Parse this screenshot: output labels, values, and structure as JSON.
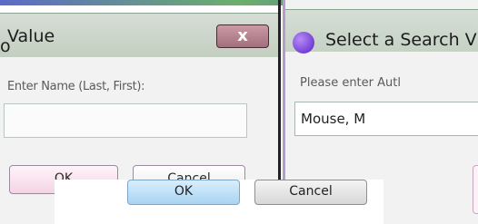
{
  "left_dialog": {
    "title": "Value",
    "close_label": "x",
    "prompt": "Enter Name (Last, First):",
    "input_value": "",
    "ok_label": "OK",
    "cancel_label": "Cancel"
  },
  "right_dialog": {
    "title": "Select a Search V",
    "prompt": "Please enter Autl",
    "input_value": "Mouse, M"
  },
  "overlay": {
    "ok_label": "OK",
    "cancel_label": "Cancel"
  },
  "colors": {
    "titlebar": "#c9d3c7",
    "close_button": "#b07d8a",
    "app_icon": "#6a2fd3",
    "ok_highlight": "#a9d3f2"
  }
}
